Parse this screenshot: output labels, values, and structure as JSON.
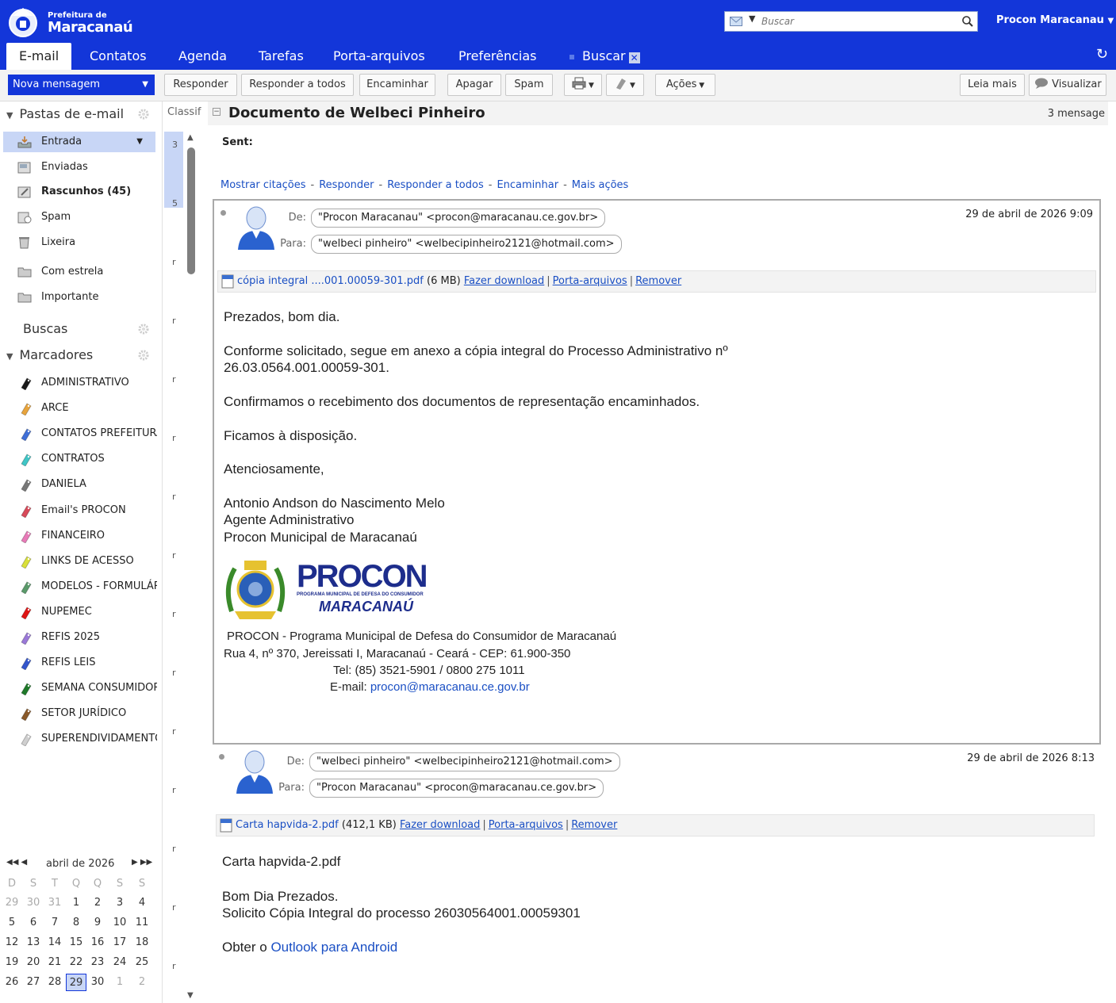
{
  "brand": {
    "line1": "Prefeitura de",
    "line2": "Maracanaú"
  },
  "search": {
    "placeholder": "Buscar"
  },
  "user": {
    "name": "Procon Maracanau"
  },
  "tabs": [
    "E-mail",
    "Contatos",
    "Agenda",
    "Tarefas",
    "Porta-arquivos",
    "Preferências",
    "Buscar"
  ],
  "toolbar": {
    "new_message": "Nova mensagem",
    "reply": "Responder",
    "reply_all": "Responder a todos",
    "forward": "Encaminhar",
    "delete": "Apagar",
    "spam": "Spam",
    "actions": "Ações",
    "read_more": "Leia mais",
    "view": "Visualizar"
  },
  "sidebar": {
    "folders_title": "Pastas de e-mail",
    "folders": [
      "Entrada",
      "Enviadas",
      "Rascunhos (45)",
      "Spam",
      "Lixeira",
      "Com estrela",
      "Importante"
    ],
    "searches_title": "Buscas",
    "tags_title": "Marcadores",
    "tags": [
      {
        "label": "ADMINISTRATIVO",
        "color": "#1a1a1a"
      },
      {
        "label": "ARCE",
        "color": "#e8a43c"
      },
      {
        "label": "CONTATOS PREFEITURA",
        "color": "#3f6fd8"
      },
      {
        "label": "CONTRATOS",
        "color": "#3fc6c6"
      },
      {
        "label": "DANIELA",
        "color": "#777777"
      },
      {
        "label": "Email's PROCON",
        "color": "#d84a5a"
      },
      {
        "label": "FINANCEIRO",
        "color": "#e87ab8"
      },
      {
        "label": "LINKS DE ACESSO",
        "color": "#d9e03a"
      },
      {
        "label": "MODELOS - FORMULÁRIOS",
        "color": "#5a9a6a"
      },
      {
        "label": "NUPEMEC",
        "color": "#e01515"
      },
      {
        "label": "REFIS 2025",
        "color": "#9a78d8"
      },
      {
        "label": "REFIS LEIS",
        "color": "#3355cc"
      },
      {
        "label": "SEMANA CONSUMIDOR",
        "color": "#1f7a2a"
      },
      {
        "label": "SETOR JURÍDICO",
        "color": "#8a5a2a"
      },
      {
        "label": "SUPERENDIVIDAMENTO",
        "color": "#cfcfcf"
      }
    ]
  },
  "calendar": {
    "month": "abril de 2026",
    "weekdays": [
      "D",
      "S",
      "T",
      "Q",
      "Q",
      "S",
      "S"
    ],
    "weeks": [
      [
        "29",
        "30",
        "31",
        "1",
        "2",
        "3",
        "4"
      ],
      [
        "5",
        "6",
        "7",
        "8",
        "9",
        "10",
        "11"
      ],
      [
        "12",
        "13",
        "14",
        "15",
        "16",
        "17",
        "18"
      ],
      [
        "19",
        "20",
        "21",
        "22",
        "23",
        "24",
        "25"
      ],
      [
        "26",
        "27",
        "28",
        "29",
        "30",
        "1",
        "2"
      ]
    ],
    "today": "29"
  },
  "list": {
    "header": "Classif",
    "marks": [
      "3",
      "5",
      "r",
      "r",
      "r",
      "r",
      "r",
      "r",
      "r",
      "r",
      "r",
      "r",
      "r",
      "r",
      "r",
      "r"
    ]
  },
  "conversation": {
    "title": "Documento de Welbeci Pinheiro",
    "count": "3 mensage",
    "sent_label": "Sent:",
    "actions": [
      "Mostrar citações",
      "Responder",
      "Responder a todos",
      "Encaminhar",
      "Mais ações"
    ]
  },
  "msg1": {
    "from_label": "De:",
    "to_label": "Para:",
    "from": "\"Procon Maracanau\" <procon@maracanau.ce.gov.br>",
    "to": "\"welbeci pinheiro\" <welbecipinheiro2121@hotmail.com>",
    "date": "29 de abril de 2026 9:09",
    "attach_name": "cópia integral ....001.00059-301.pdf",
    "attach_size": "(6 MB)",
    "download": "Fazer download",
    "briefcase": "Porta-arquivos",
    "remove": "Remover",
    "body": [
      "Prezados, bom dia.",
      "Conforme solicitado, segue em anexo a cópia integral do Processo Administrativo nº",
      "26.03.0564.001.00059-301.",
      "Confirmamos o recebimento dos documentos de representação encaminhados.",
      "Ficamos à disposição.",
      "Atenciosamente,",
      "Antonio Andson do Nascimento Melo",
      "Agente Administrativo",
      "Procon Municipal de Maracanaú"
    ],
    "logo_word": "PROCON",
    "logo_sub": "PROGRAMA MUNICIPAL DE DEFESA DO CONSUMIDOR",
    "logo_city": "MARACANAÚ",
    "sig": [
      "PROCON - Programa Municipal de Defesa do Consumidor de Maracanaú",
      "Rua 4, nº 370, Jereissati I, Maracanaú - Ceará - CEP: 61.900-350",
      "Tel: (85) 3521-5901 / 0800 275 1011"
    ],
    "email_label": "E-mail:",
    "email": "procon@maracanau.ce.gov.br"
  },
  "msg2": {
    "from_label": "De:",
    "to_label": "Para:",
    "from": "\"welbeci pinheiro\" <welbecipinheiro2121@hotmail.com>",
    "to": "\"Procon Maracanau\" <procon@maracanau.ce.gov.br>",
    "date": "29 de abril de 2026 8:13",
    "attach_name": "Carta hapvida-2.pdf",
    "attach_size": "(412,1 KB)",
    "download": "Fazer download",
    "briefcase": "Porta-arquivos",
    "remove": "Remover",
    "body": [
      "Carta hapvida-2.pdf",
      "Bom Dia Prezados.",
      "Solicito Cópia Integral do processo 26030564001.00059301"
    ],
    "footer_prefix": "Obter o",
    "footer_link": "Outlook para Android"
  }
}
